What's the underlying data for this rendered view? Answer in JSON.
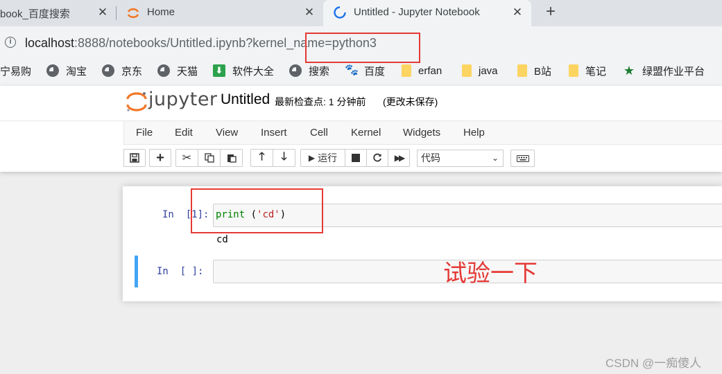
{
  "browser": {
    "tabs": [
      {
        "title": "book_百度搜索",
        "close": "✕"
      },
      {
        "title": "Home",
        "close": "✕"
      },
      {
        "title": "Untitled - Jupyter Notebook",
        "close": "✕"
      }
    ],
    "new_tab": "+",
    "url_host": "localhost",
    "url_rest": ":8888/notebooks/Untitled.ipynb?kernel_name=python3",
    "bookmarks": [
      {
        "label": "宁易购",
        "icon": "none"
      },
      {
        "label": "淘宝",
        "icon": "globe-icon"
      },
      {
        "label": "京东",
        "icon": "globe-icon"
      },
      {
        "label": "天猫",
        "icon": "globe-icon"
      },
      {
        "label": "软件大全",
        "icon": "download-icon"
      },
      {
        "label": "搜索",
        "icon": "globe-icon"
      },
      {
        "label": "百度",
        "icon": "baidu-icon"
      },
      {
        "label": "erfan",
        "icon": "folder-icon"
      },
      {
        "label": "java",
        "icon": "folder-icon"
      },
      {
        "label": "B站",
        "icon": "folder-icon"
      },
      {
        "label": "笔记",
        "icon": "folder-icon"
      },
      {
        "label": "绿盟作业平台",
        "icon": "star-icon"
      }
    ]
  },
  "jupyter": {
    "logo_text": "jupyter",
    "notebook_name": "Untitled",
    "checkpoint": "最新检查点: 1 分钟前",
    "autosave": "(更改未保存)",
    "menu": [
      "File",
      "Edit",
      "View",
      "Insert",
      "Cell",
      "Kernel",
      "Widgets",
      "Help"
    ],
    "toolbar": {
      "run_label": "运行",
      "cell_type": "代码"
    },
    "cells": [
      {
        "prompt": "In  [1]:",
        "code_kw": "print",
        "code_rest": " (",
        "code_str": "'cd'",
        "code_end": ")",
        "output": "cd"
      },
      {
        "prompt": "In  [ ]:",
        "code": ""
      }
    ]
  },
  "annotation": {
    "text": "试验一下",
    "color": "#e53935"
  },
  "watermark": "CSDN @一痴傻人"
}
